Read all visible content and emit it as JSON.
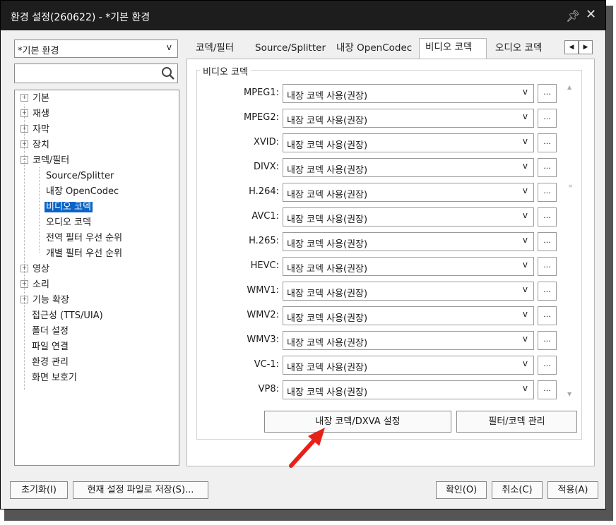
{
  "window": {
    "title": "환경 설정(260622) - *기본 환경",
    "pin_icon": "pin-icon",
    "close_icon": "close-icon"
  },
  "profile_select": {
    "value": "*기본 환경",
    "arrow": "v"
  },
  "search": {
    "value": "",
    "icon": "search-icon"
  },
  "tree": [
    {
      "label": "기본",
      "expander": "+"
    },
    {
      "label": "재생",
      "expander": "+"
    },
    {
      "label": "자막",
      "expander": "+"
    },
    {
      "label": "장치",
      "expander": "+"
    },
    {
      "label": "코덱/필터",
      "expander": "−"
    },
    {
      "label": "Source/Splitter"
    },
    {
      "label": "내장 OpenCodec"
    },
    {
      "label": "비디오 코덱",
      "selected": true
    },
    {
      "label": "오디오 코덱"
    },
    {
      "label": "전역 필터 우선 순위"
    },
    {
      "label": "개별 필터 우선 순위"
    },
    {
      "label": "영상",
      "expander": "+"
    },
    {
      "label": "소리",
      "expander": "+"
    },
    {
      "label": "기능 확장",
      "expander": "+"
    },
    {
      "label": "접근성 (TTS/UIA)"
    },
    {
      "label": "폴더 설정"
    },
    {
      "label": "파일 연결"
    },
    {
      "label": "환경 관리"
    },
    {
      "label": "화면 보호기"
    }
  ],
  "tabs": [
    {
      "label": "코덱/필터"
    },
    {
      "label": "Source/Splitter"
    },
    {
      "label": "내장 OpenCodec"
    },
    {
      "label": "비디오 코덱",
      "active": true
    },
    {
      "label": "오디오 코덱"
    }
  ],
  "tab_scroll": {
    "left": "◀",
    "right": "▶"
  },
  "group_title": "비디오 코덱",
  "codec_rows": [
    {
      "label": "MPEG1:",
      "value": "내장 코덱 사용(권장)"
    },
    {
      "label": "MPEG2:",
      "value": "내장 코덱 사용(권장)"
    },
    {
      "label": "XVID:",
      "value": "내장 코덱 사용(권장)"
    },
    {
      "label": "DIVX:",
      "value": "내장 코덱 사용(권장)"
    },
    {
      "label": "H.264:",
      "value": "내장 코덱 사용(권장)"
    },
    {
      "label": "AVC1:",
      "value": "내장 코덱 사용(권장)"
    },
    {
      "label": "H.265:",
      "value": "내장 코덱 사용(권장)"
    },
    {
      "label": "HEVC:",
      "value": "내장 코덱 사용(권장)"
    },
    {
      "label": "WMV1:",
      "value": "내장 코덱 사용(권장)"
    },
    {
      "label": "WMV2:",
      "value": "내장 코덱 사용(권장)"
    },
    {
      "label": "WMV3:",
      "value": "내장 코덱 사용(권장)"
    },
    {
      "label": "VC-1:",
      "value": "내장 코덱 사용(권장)"
    },
    {
      "label": "VP8:",
      "value": "내장 코덱 사용(권장)"
    }
  ],
  "dropdown_arrow": "v",
  "ellipsis_label": "...",
  "buttons": {
    "dxva": "내장 코덱/DXVA 설정",
    "filter_manage": "필터/코덱 관리",
    "reset": "초기화(I)",
    "save_current": "현재 설정 파일로 저장(S)...",
    "ok": "확인(O)",
    "cancel": "취소(C)",
    "apply": "적용(A)"
  },
  "colors": {
    "titlebar": "#1d1d1d",
    "selection": "#0a64c8",
    "annotation_arrow": "#e8201a"
  }
}
